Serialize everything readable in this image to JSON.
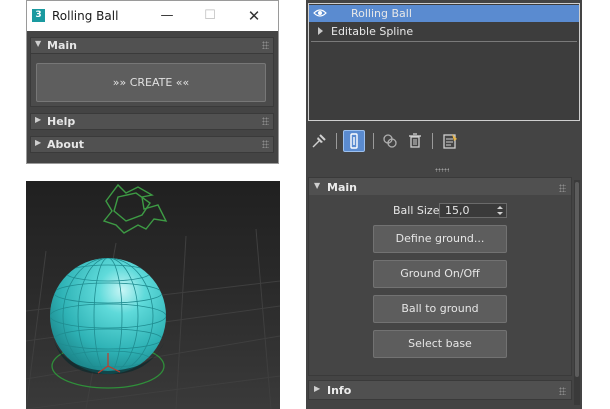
{
  "script_window": {
    "app_icon_text": "3",
    "title": "Rolling Ball",
    "rollouts": {
      "main": {
        "title": "Main",
        "create_label": "»» CREATE ««"
      },
      "help": {
        "title": "Help"
      },
      "about": {
        "title": "About"
      }
    }
  },
  "modifier_stack": {
    "items": [
      {
        "label": "Rolling Ball",
        "selected": true
      },
      {
        "label": "Editable Spline",
        "selected": false
      }
    ]
  },
  "stack_toolbar": {
    "icons": [
      "pin-stack-icon",
      "show-end-result-icon",
      "make-unique-icon",
      "remove-modifier-icon",
      "configure-modifier-sets-icon"
    ]
  },
  "command_panel": {
    "main_rollout": {
      "title": "Main",
      "ball_size_label": "Ball Size:",
      "ball_size_value": "15,0",
      "buttons": {
        "define_ground": "Define ground...",
        "ground_onoff": "Ground On/Off",
        "ball_to_ground": "Ball to ground",
        "select_base": "Select base"
      }
    },
    "info_rollout": {
      "title": "Info"
    }
  },
  "colors": {
    "selection_blue": "#5a8bd0",
    "panel_gray": "#444444",
    "ball_teal": "#3fc8c8",
    "gizmo_green": "#2f8f3a"
  }
}
